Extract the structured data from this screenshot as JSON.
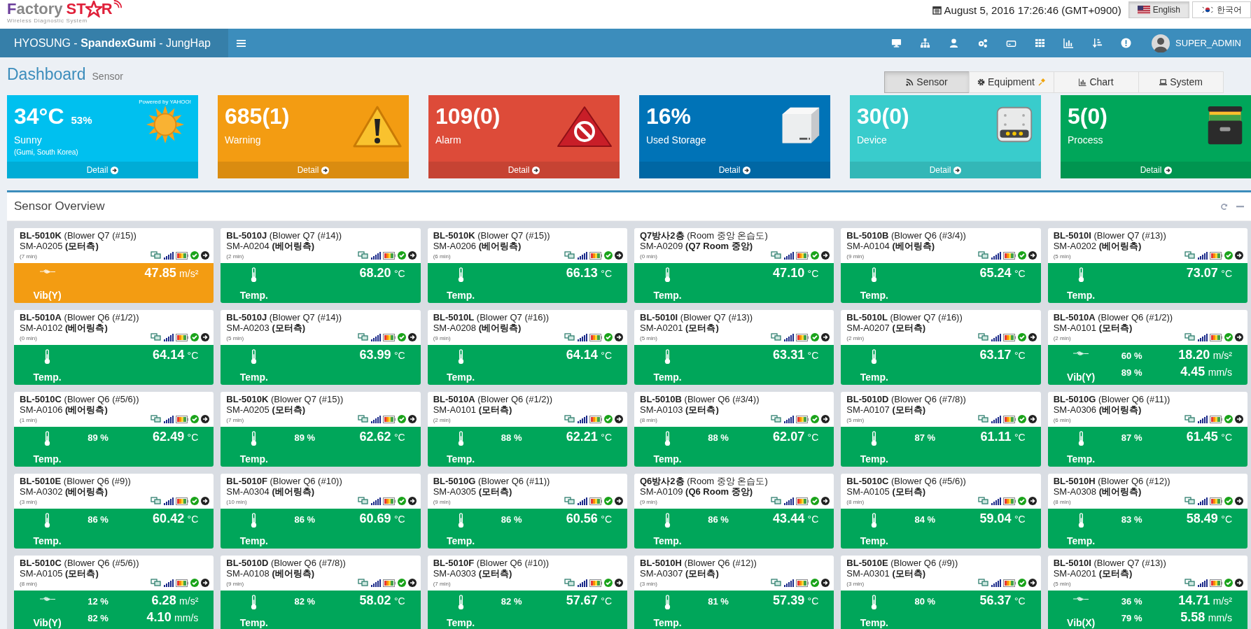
{
  "logo": {
    "word": "Factory",
    "star_left": "ST",
    "star_right": "R",
    "tagline": "Wireless Diagnostic System"
  },
  "datetime": "August 5, 2016 17:26:46 (GMT+0900)",
  "languages": [
    {
      "label": "English",
      "selected": true
    },
    {
      "label": "한국어",
      "selected": false
    }
  ],
  "navbar": {
    "title": "HYOSUNG - **SpandexGumi** - JungHap",
    "user": "SUPER_ADMIN"
  },
  "page": {
    "title": "Dashboard",
    "subtitle": "Sensor"
  },
  "tabs": [
    {
      "label": "Sensor",
      "pinned": false,
      "selected": true
    },
    {
      "label": "Equipment",
      "pinned": true,
      "selected": false
    },
    {
      "label": "Chart",
      "pinned": false,
      "selected": false
    },
    {
      "label": "System",
      "pinned": false,
      "selected": false
    }
  ],
  "stats": [
    {
      "kind": "weather",
      "color": "#00c0ef",
      "value": "34°C",
      "extra": "53%",
      "label": "Sunny",
      "sub": "(Gumi, South Korea)",
      "credit": "Powered by YAHOO!",
      "footer": "Detail"
    },
    {
      "kind": "warning",
      "color": "#f39c12",
      "value": "685(1)",
      "label": "Warning",
      "footer": "Detail"
    },
    {
      "kind": "alarm",
      "color": "#dd4b39",
      "value": "109(0)",
      "label": "Alarm",
      "footer": "Detail"
    },
    {
      "kind": "storage",
      "color": "#0073b7",
      "value": "16%",
      "label": "Used Storage",
      "footer": "Detail"
    },
    {
      "kind": "device",
      "color": "#39cccc",
      "value": "30(0)",
      "label": "Device",
      "footer": "Detail"
    },
    {
      "kind": "process",
      "color": "#00a65a",
      "value": "5(0)",
      "label": "Process",
      "footer": "Detail"
    }
  ],
  "overview": {
    "title": "Sensor Overview"
  },
  "cards": [
    {
      "name": "BL-5010K",
      "desc": "(Blower Q7 (#15))",
      "sensor": "SM-A0205",
      "location": "(모터측)",
      "age": "(7 min)",
      "warning": true,
      "kind": "vib",
      "label": "Vib(Y)",
      "readings": [
        {
          "value": "47.85",
          "unit": "m/s²"
        }
      ]
    },
    {
      "name": "BL-5010J",
      "desc": "(Blower Q7 (#14))",
      "sensor": "SM-A0204",
      "location": "(베어링측)",
      "age": "(2 min)",
      "warning": false,
      "kind": "temp",
      "label": "Temp.",
      "readings": [
        {
          "value": "68.20",
          "unit": "°C"
        }
      ]
    },
    {
      "name": "BL-5010K",
      "desc": "(Blower Q7 (#15))",
      "sensor": "SM-A0206",
      "location": "(베어링측)",
      "age": "(6 min)",
      "warning": false,
      "kind": "temp",
      "label": "Temp.",
      "readings": [
        {
          "value": "66.13",
          "unit": "°C"
        }
      ]
    },
    {
      "name": "Q7방사2층",
      "desc": "(Room 중앙 온습도)",
      "sensor": "SM-A0209",
      "location": "(Q7 Room 중앙)",
      "age": "(0 min)",
      "warning": false,
      "kind": "temp",
      "label": "Temp.",
      "readings": [
        {
          "value": "47.10",
          "unit": "°C"
        }
      ]
    },
    {
      "name": "BL-5010B",
      "desc": "(Blower Q6 (#3/4))",
      "sensor": "SM-A0104",
      "location": "(베어링측)",
      "age": "(9 min)",
      "warning": false,
      "kind": "temp",
      "label": "Temp.",
      "readings": [
        {
          "value": "65.24",
          "unit": "°C"
        }
      ]
    },
    {
      "name": "BL-5010I",
      "desc": "(Blower Q7 (#13))",
      "sensor": "SM-A0202",
      "location": "(베어링측)",
      "age": "(5 min)",
      "warning": false,
      "kind": "temp",
      "label": "Temp.",
      "readings": [
        {
          "value": "73.07",
          "unit": "°C"
        }
      ]
    },
    {
      "name": "BL-5010A",
      "desc": "(Blower Q6 (#1/2))",
      "sensor": "SM-A0102",
      "location": "(베어링측)",
      "age": "(0 min)",
      "warning": false,
      "kind": "temp",
      "label": "Temp.",
      "readings": [
        {
          "value": "64.14",
          "unit": "°C"
        }
      ]
    },
    {
      "name": "BL-5010J",
      "desc": "(Blower Q7 (#14))",
      "sensor": "SM-A0203",
      "location": "(모터측)",
      "age": "(5 min)",
      "warning": false,
      "kind": "temp",
      "label": "Temp.",
      "readings": [
        {
          "value": "63.99",
          "unit": "°C"
        }
      ]
    },
    {
      "name": "BL-5010L",
      "desc": "(Blower Q7 (#16))",
      "sensor": "SM-A0208",
      "location": "(베어링측)",
      "age": "(9 min)",
      "warning": false,
      "kind": "temp",
      "label": "Temp.",
      "readings": [
        {
          "value": "64.14",
          "unit": "°C"
        }
      ]
    },
    {
      "name": "BL-5010I",
      "desc": "(Blower Q7 (#13))",
      "sensor": "SM-A0201",
      "location": "(모터측)",
      "age": "(5 min)",
      "warning": false,
      "kind": "temp",
      "label": "Temp.",
      "readings": [
        {
          "value": "63.31",
          "unit": "°C"
        }
      ]
    },
    {
      "name": "BL-5010L",
      "desc": "(Blower Q7 (#16))",
      "sensor": "SM-A0207",
      "location": "(모터측)",
      "age": "(2 min)",
      "warning": false,
      "kind": "temp",
      "label": "Temp.",
      "readings": [
        {
          "value": "63.17",
          "unit": "°C"
        }
      ]
    },
    {
      "name": "BL-5010A",
      "desc": "(Blower Q6 (#1/2))",
      "sensor": "SM-A0101",
      "location": "(모터측)",
      "age": "(2 min)",
      "warning": false,
      "kind": "vib",
      "label": "Vib(Y)",
      "readings": [
        {
          "percent": "60 %",
          "value": "18.20",
          "unit": "m/s²"
        },
        {
          "percent": "89 %",
          "value": "4.45",
          "unit": "mm/s"
        }
      ]
    },
    {
      "name": "BL-5010C",
      "desc": "(Blower Q6 (#5/6))",
      "sensor": "SM-A0106",
      "location": "(베어링측)",
      "age": "(1 min)",
      "warning": false,
      "kind": "temp",
      "label": "Temp.",
      "readings": [
        {
          "percent": "89 %",
          "value": "62.49",
          "unit": "°C"
        }
      ]
    },
    {
      "name": "BL-5010K",
      "desc": "(Blower Q7 (#15))",
      "sensor": "SM-A0205",
      "location": "(모터측)",
      "age": "(7 min)",
      "warning": false,
      "kind": "temp",
      "label": "Temp.",
      "readings": [
        {
          "percent": "89 %",
          "value": "62.62",
          "unit": "°C"
        }
      ]
    },
    {
      "name": "BL-5010A",
      "desc": "(Blower Q6 (#1/2))",
      "sensor": "SM-A0101",
      "location": "(모터측)",
      "age": "(2 min)",
      "warning": false,
      "kind": "temp",
      "label": "Temp.",
      "readings": [
        {
          "percent": "88 %",
          "value": "62.21",
          "unit": "°C"
        }
      ]
    },
    {
      "name": "BL-5010B",
      "desc": "(Blower Q6 (#3/4))",
      "sensor": "SM-A0103",
      "location": "(모터측)",
      "age": "(8 min)",
      "warning": false,
      "kind": "temp",
      "label": "Temp.",
      "readings": [
        {
          "percent": "88 %",
          "value": "62.07",
          "unit": "°C"
        }
      ]
    },
    {
      "name": "BL-5010D",
      "desc": "(Blower Q6 (#7/8))",
      "sensor": "SM-A0107",
      "location": "(모터측)",
      "age": "(5 min)",
      "warning": false,
      "kind": "temp",
      "label": "Temp.",
      "readings": [
        {
          "percent": "87 %",
          "value": "61.11",
          "unit": "°C"
        }
      ]
    },
    {
      "name": "BL-5010G",
      "desc": "(Blower Q6 (#11))",
      "sensor": "SM-A0306",
      "location": "(베어링측)",
      "age": "(6 min)",
      "warning": false,
      "kind": "temp",
      "label": "Temp.",
      "readings": [
        {
          "percent": "87 %",
          "value": "61.45",
          "unit": "°C"
        }
      ]
    },
    {
      "name": "BL-5010E",
      "desc": "(Blower Q6 (#9))",
      "sensor": "SM-A0302",
      "location": "(베어링측)",
      "age": "(3 min)",
      "warning": false,
      "kind": "temp",
      "label": "Temp.",
      "readings": [
        {
          "percent": "86 %",
          "value": "60.42",
          "unit": "°C"
        }
      ]
    },
    {
      "name": "BL-5010F",
      "desc": "(Blower Q6 (#10))",
      "sensor": "SM-A0304",
      "location": "(베어링측)",
      "age": "(10 min)",
      "warning": false,
      "kind": "temp",
      "label": "Temp.",
      "readings": [
        {
          "percent": "86 %",
          "value": "60.69",
          "unit": "°C"
        }
      ]
    },
    {
      "name": "BL-5010G",
      "desc": "(Blower Q6 (#11))",
      "sensor": "SM-A0305",
      "location": "(모터측)",
      "age": "(9 min)",
      "warning": false,
      "kind": "temp",
      "label": "Temp.",
      "readings": [
        {
          "percent": "86 %",
          "value": "60.56",
          "unit": "°C"
        }
      ]
    },
    {
      "name": "Q6방사2층",
      "desc": "(Room 중앙 온습도)",
      "sensor": "SM-A0109",
      "location": "(Q6 Room 중앙)",
      "age": "(9 min)",
      "warning": false,
      "kind": "temp",
      "label": "Temp.",
      "readings": [
        {
          "percent": "86 %",
          "value": "43.44",
          "unit": "°C"
        }
      ]
    },
    {
      "name": "BL-5010C",
      "desc": "(Blower Q6 (#5/6))",
      "sensor": "SM-A0105",
      "location": "(모터측)",
      "age": "(8 min)",
      "warning": false,
      "kind": "temp",
      "label": "Temp.",
      "readings": [
        {
          "percent": "84 %",
          "value": "59.04",
          "unit": "°C"
        }
      ]
    },
    {
      "name": "BL-5010H",
      "desc": "(Blower Q6 (#12))",
      "sensor": "SM-A0308",
      "location": "(베어링측)",
      "age": "(8 min)",
      "warning": false,
      "kind": "temp",
      "label": "Temp.",
      "readings": [
        {
          "percent": "83 %",
          "value": "58.49",
          "unit": "°C"
        }
      ]
    },
    {
      "name": "BL-5010C",
      "desc": "(Blower Q6 (#5/6))",
      "sensor": "SM-A0105",
      "location": "(모터측)",
      "age": "(8 min)",
      "warning": false,
      "kind": "vib",
      "label": "Vib(Y)",
      "readings": [
        {
          "percent": "12 %",
          "value": "6.28",
          "unit": "m/s²"
        },
        {
          "percent": "82 %",
          "value": "4.10",
          "unit": "mm/s"
        }
      ]
    },
    {
      "name": "BL-5010D",
      "desc": "(Blower Q6 (#7/8))",
      "sensor": "SM-A0108",
      "location": "(베어링측)",
      "age": "(9 min)",
      "warning": false,
      "kind": "temp",
      "label": "Temp.",
      "readings": [
        {
          "percent": "82 %",
          "value": "58.02",
          "unit": "°C"
        }
      ]
    },
    {
      "name": "BL-5010F",
      "desc": "(Blower Q6 (#10))",
      "sensor": "SM-A0303",
      "location": "(모터측)",
      "age": "(7 min)",
      "warning": false,
      "kind": "temp",
      "label": "Temp.",
      "readings": [
        {
          "percent": "82 %",
          "value": "57.67",
          "unit": "°C"
        }
      ]
    },
    {
      "name": "BL-5010H",
      "desc": "(Blower Q6 (#12))",
      "sensor": "SM-A0307",
      "location": "(모터측)",
      "age": "(3 min)",
      "warning": false,
      "kind": "temp",
      "label": "Temp.",
      "readings": [
        {
          "percent": "81 %",
          "value": "57.39",
          "unit": "°C"
        }
      ]
    },
    {
      "name": "BL-5010E",
      "desc": "(Blower Q6 (#9))",
      "sensor": "SM-A0301",
      "location": "(모터측)",
      "age": "(3 min)",
      "warning": false,
      "kind": "temp",
      "label": "Temp.",
      "readings": [
        {
          "percent": "80 %",
          "value": "56.37",
          "unit": "°C"
        }
      ]
    },
    {
      "name": "BL-5010I",
      "desc": "(Blower Q7 (#13))",
      "sensor": "SM-A0201",
      "location": "(모터측)",
      "age": "(5 min)",
      "warning": false,
      "kind": "vib",
      "label": "Vib(X)",
      "readings": [
        {
          "percent": "36 %",
          "value": "14.71",
          "unit": "m/s²"
        },
        {
          "percent": "79 %",
          "value": "5.58",
          "unit": "mm/s"
        }
      ]
    }
  ]
}
